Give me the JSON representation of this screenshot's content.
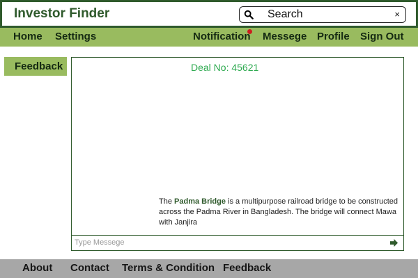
{
  "app": {
    "title": "Investor Finder"
  },
  "search": {
    "placeholder": "Search",
    "value": "",
    "clear_icon": "×"
  },
  "nav": {
    "left": [
      {
        "label": "Home"
      },
      {
        "label": "Settings"
      }
    ],
    "right": [
      {
        "label": "Notification",
        "has_badge": true
      },
      {
        "label": "Messege"
      },
      {
        "label": "Profile"
      },
      {
        "label": "Sign Out"
      }
    ]
  },
  "sidebar": {
    "feedback_label": "Feedback"
  },
  "chat": {
    "deal_label": "Deal No: 45621",
    "message": {
      "prefix": "The ",
      "highlight": "Padma Bridge",
      "suffix": " is a multipurpose railroad bridge to be constructed across the Padma River in Bangladesh. The bridge will connect Mawa with Janjira"
    },
    "input_placeholder": "Type Messege",
    "send_icon": "send-arrow-icon"
  },
  "footer": {
    "links": [
      "About",
      "Contact",
      "Terms & Condition",
      "Feedback"
    ]
  },
  "colors": {
    "brand": "#2f5a2c",
    "nav_bg": "#99bb5f",
    "accent_text": "#2eaa50",
    "footer_bg": "#a7a7a7",
    "notification_badge": "#cc1f1f"
  }
}
